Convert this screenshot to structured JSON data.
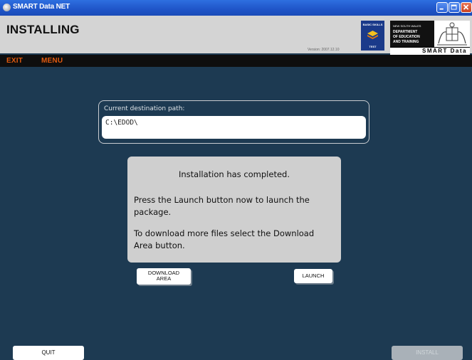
{
  "window": {
    "title": "SMART Data NET"
  },
  "header": {
    "heading": "INSTALLING",
    "version": "Version: 2007.12.10",
    "test_logo": {
      "line1": "BASIC SKILLS",
      "line2": "TEST"
    },
    "dept_logo": {
      "lines": [
        "NEW SOUTH WALES",
        "DEPARTMENT",
        "OF EDUCATION",
        "AND TRAINING"
      ]
    },
    "brand": "SMART Data"
  },
  "menu": {
    "exit": "EXIT",
    "menu": "MENU"
  },
  "destination": {
    "label": "Current destination path:",
    "value": "C:\\EDOD\\"
  },
  "dialog": {
    "heading": "Installation has completed.",
    "line1": "Press the Launch button now to launch the",
    "line2": "package.",
    "line3": "To download more files select the Download",
    "line4": "Area button."
  },
  "buttons": {
    "download_line1": "DOWNLOAD",
    "download_line2": "AREA",
    "launch": "LAUNCH",
    "quit": "QUIT",
    "install": "INSTALL"
  },
  "colors": {
    "background": "#1d3a52",
    "titlebar": "#2563d6",
    "menu_text": "#e05a10",
    "dialog": "#cfcfcf"
  }
}
